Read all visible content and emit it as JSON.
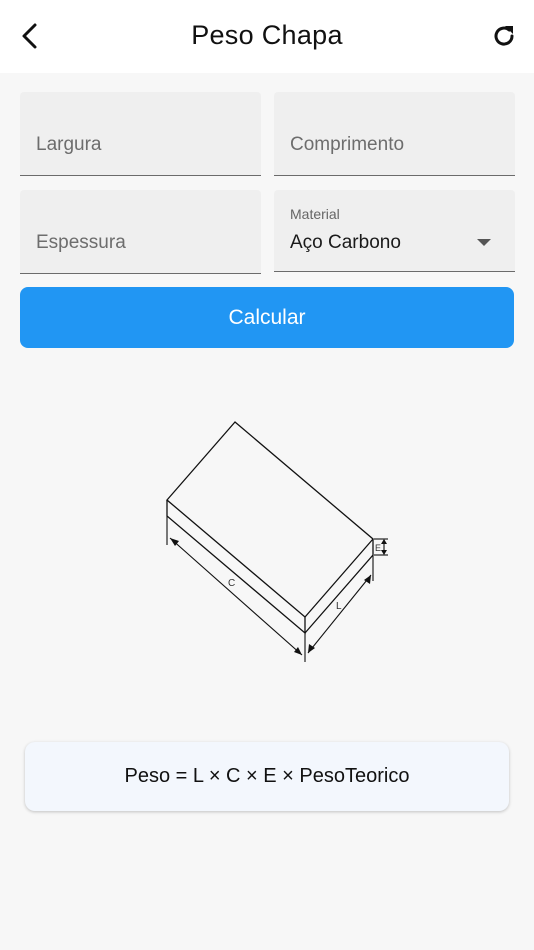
{
  "app_bar": {
    "title": "Peso Chapa",
    "back_icon": "chevron-left-icon",
    "refresh_icon": "refresh-icon"
  },
  "form": {
    "largura_placeholder": "Largura",
    "comprimento_placeholder": "Comprimento",
    "espessura_placeholder": "Espessura",
    "material_label": "Material",
    "material_value": "Aço Carbono"
  },
  "calc_button": {
    "label": "Calcular",
    "color": "#2196f3"
  },
  "diagram": {
    "label_c": "C",
    "label_l": "L",
    "label_e": "E"
  },
  "formula": "Peso = L × C × E × PesoTeorico"
}
